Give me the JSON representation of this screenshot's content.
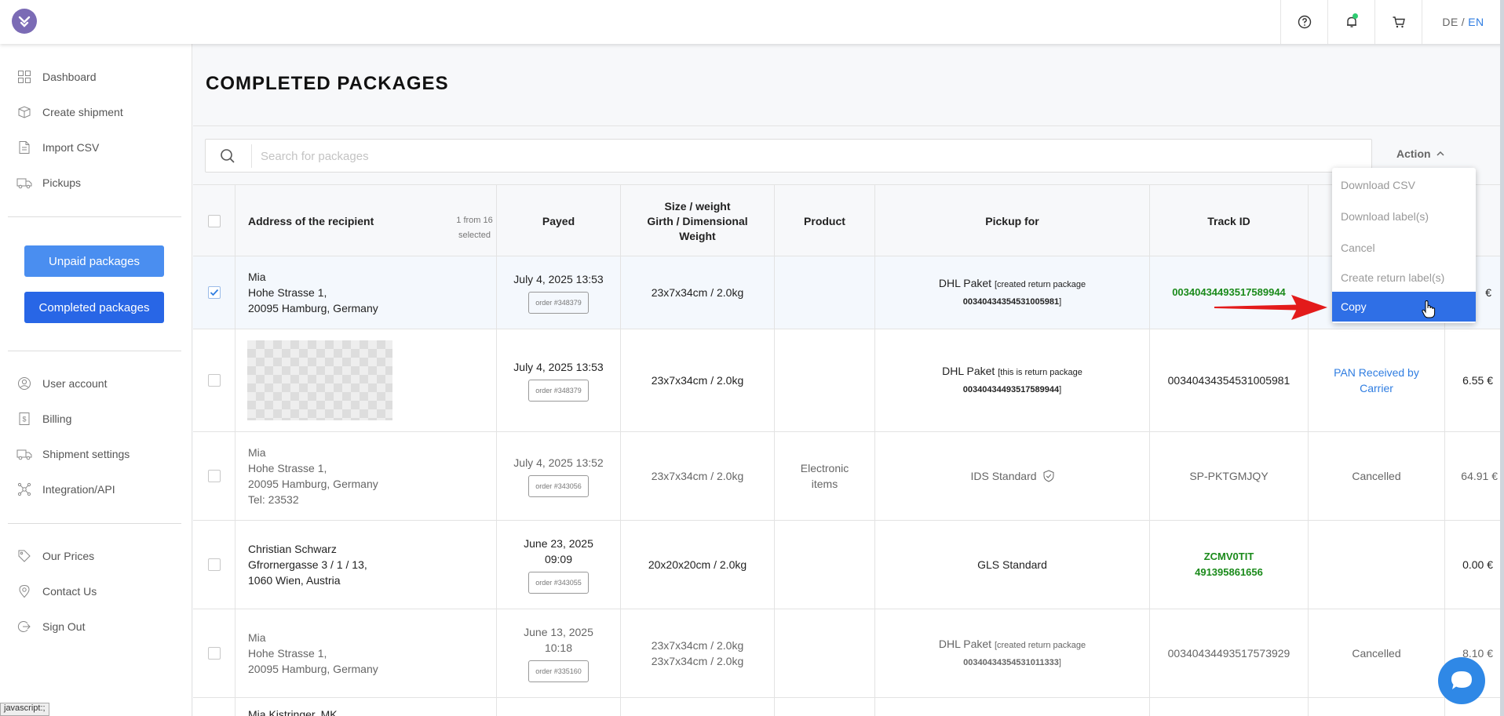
{
  "header": {
    "lang_de": "DE",
    "lang_sep": "/",
    "lang_en": "EN",
    "icons": [
      "help-icon",
      "bell-icon",
      "cart-icon"
    ]
  },
  "sidebar": {
    "top_items": [
      {
        "label": "Dashboard",
        "icon": "dashboard-icon"
      },
      {
        "label": "Create shipment",
        "icon": "box-icon"
      },
      {
        "label": "Import CSV",
        "icon": "file-icon"
      },
      {
        "label": "Pickups",
        "icon": "truck-icon"
      }
    ],
    "unpaid_label": "Unpaid packages",
    "completed_label": "Completed packages",
    "account_items": [
      {
        "label": "User account",
        "icon": "user-icon"
      },
      {
        "label": "Billing",
        "icon": "billing-icon"
      },
      {
        "label": "Shipment settings",
        "icon": "truck-settings-icon"
      },
      {
        "label": "Integration/API",
        "icon": "api-icon"
      }
    ],
    "bottom_items": [
      {
        "label": "Our Prices",
        "icon": "price-tag-icon"
      },
      {
        "label": "Contact Us",
        "icon": "location-pin-icon"
      },
      {
        "label": "Sign Out",
        "icon": "sign-out-icon"
      }
    ]
  },
  "page": {
    "title": "COMPLETED PACKAGES",
    "search_placeholder": "Search for packages",
    "action_label": "Action"
  },
  "table": {
    "headers": {
      "address": "Address of the recipient",
      "selected_count": "1 from 16 selected",
      "payed": "Payed",
      "size_line1": "Size / weight",
      "size_line2": "Girth / Dimensional",
      "size_line3": "Weight",
      "product": "Product",
      "pickup": "Pickup for",
      "track": "Track ID"
    },
    "rows": [
      {
        "address": [
          "Mia",
          "Hohe Strasse 1,",
          "20095 Hamburg, Germany"
        ],
        "payed": "July 4, 2025 13:53",
        "order": "order #348379",
        "size": "23x7x34cm / 2.0kg",
        "pickup_carrier": "DHL Paket",
        "pickup_note": "[created return package",
        "pickup_ref": "00340434354531005981",
        "pickup_close": "]",
        "track": "00340434493517589944",
        "status": "",
        "price": "€"
      },
      {
        "payed": "July 4, 2025 13:53",
        "order": "order #348379",
        "size": "23x7x34cm / 2.0kg",
        "pickup_carrier": "DHL Paket",
        "pickup_note": "[this is return package",
        "pickup_ref": "00340434493517589944",
        "pickup_close": "]",
        "track": "00340434354531005981",
        "status_line1": "PAN Received by",
        "status_line2": "Carrier",
        "price": "6.55 €"
      },
      {
        "address": [
          "Mia",
          "Hohe Strasse 1,",
          "20095 Hamburg, Germany",
          "Tel: 23532"
        ],
        "payed": "July 4, 2025 13:52",
        "order": "order #343056",
        "size": "23x7x34cm / 2.0kg",
        "product_line1": "Electronic",
        "product_line2": "items",
        "pickup_carrier": "IDS Standard",
        "track": "SP-PKTGMJQY",
        "status": "Cancelled",
        "price": "64.91 €"
      },
      {
        "address": [
          "Christian Schwarz",
          "Gfrornergasse 3 / 1 / 13,",
          "1060 Wien, Austria"
        ],
        "payed_line1": "June 23, 2025",
        "payed_line2": "09:09",
        "order": "order #343055",
        "size": "20x20x20cm / 2.0kg",
        "pickup_carrier": "GLS Standard",
        "track_line1": "ZCMV0TIT",
        "track_line2": "491395861656",
        "price": "0.00 €"
      },
      {
        "address": [
          "Mia",
          "Hohe Strasse 1,",
          "20095 Hamburg, Germany"
        ],
        "payed_line1": "June 13, 2025",
        "payed_line2": "10:18",
        "order": "order #335160",
        "size_line1": "23x7x34cm / 2.0kg",
        "size_line2": "23x7x34cm / 2.0kg",
        "pickup_carrier": "DHL Paket",
        "pickup_note": "[created return package",
        "pickup_ref": "00340434354531011333",
        "pickup_close": "]",
        "track": "00340434493517573929",
        "status": "Cancelled",
        "price": "8.10 €"
      },
      {
        "address_partial": "Mia Kistringer, MK"
      }
    ]
  },
  "dropdown": {
    "items": [
      "Download CSV",
      "Download label(s)",
      "Cancel",
      "Create return label(s)",
      "Copy"
    ]
  },
  "status_tip": "javascript:;",
  "colors": {
    "accent": "#2f7de1",
    "completed_button": "#2866e6",
    "unpaid_button": "#4a8ef0",
    "track_green": "#1a8a1a",
    "arrow_red": "#e31b1b"
  }
}
